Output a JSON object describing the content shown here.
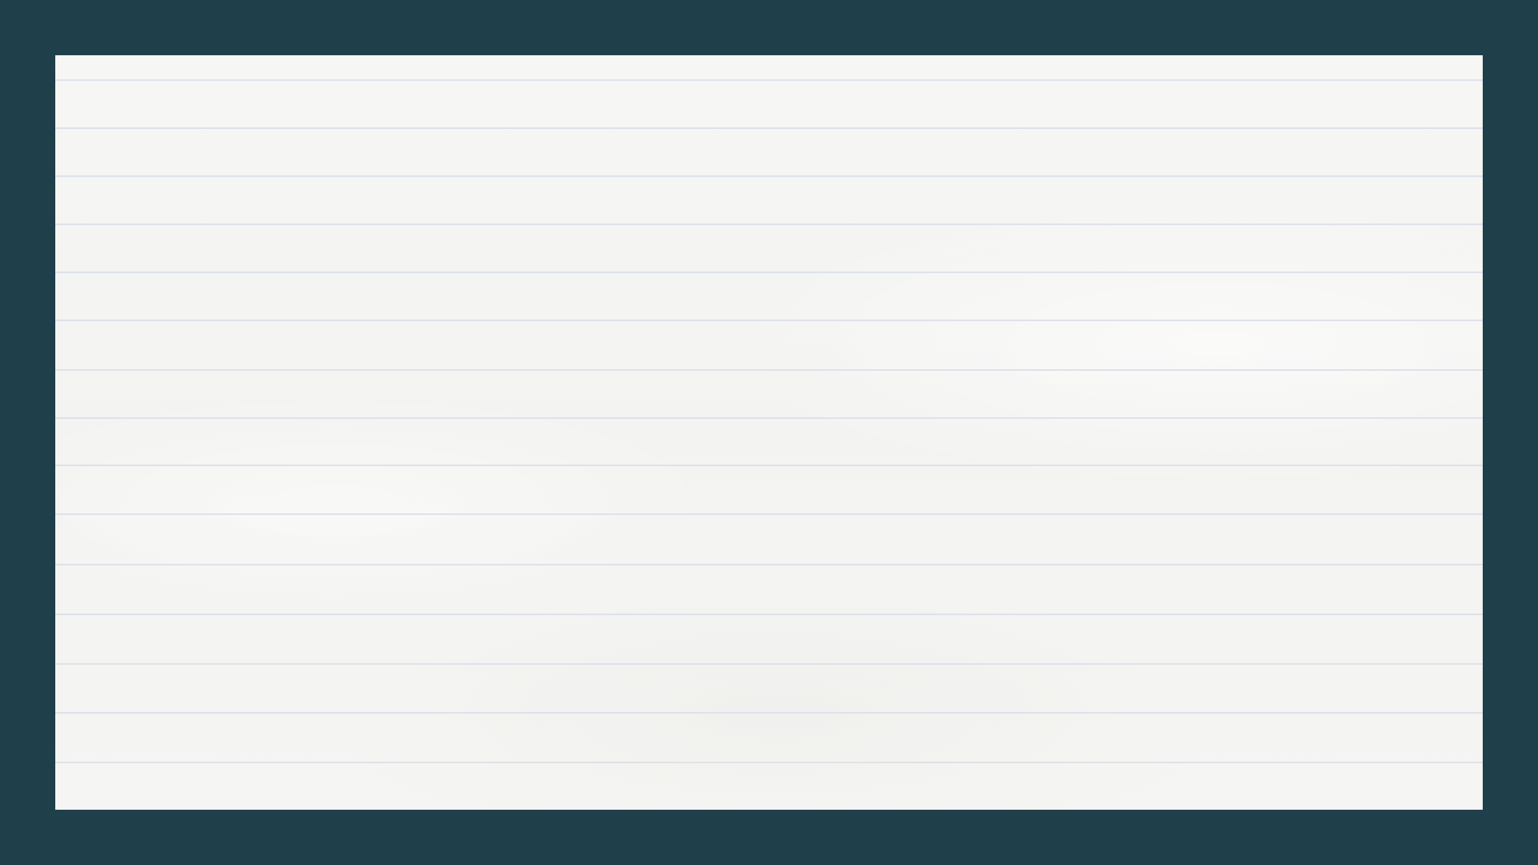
{
  "colors": {
    "background": "#1f3f4a",
    "paper": "#f5f5f3",
    "rule_line": "#dde2ea"
  }
}
